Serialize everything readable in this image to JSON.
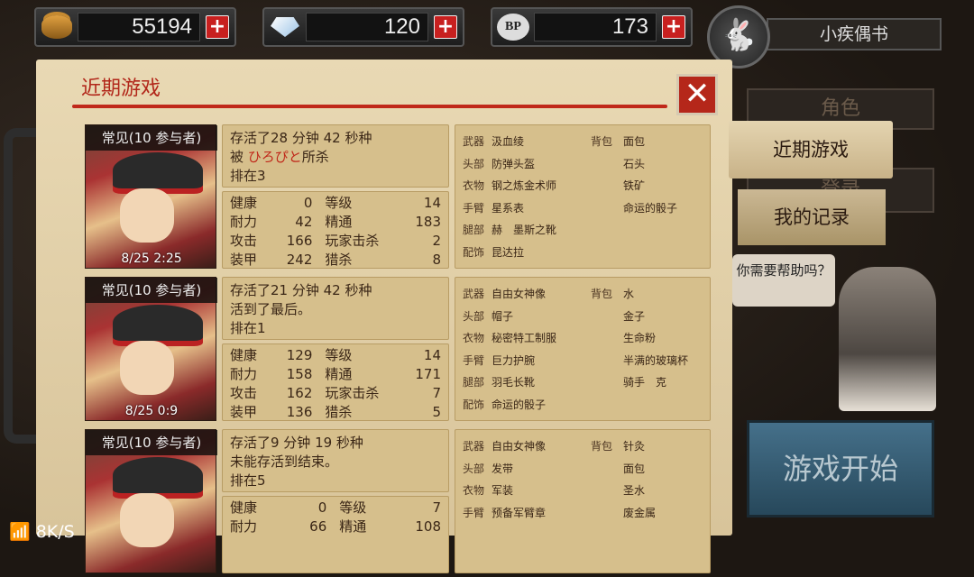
{
  "currency": {
    "gold": {
      "icon": "coin-stack-icon",
      "value": "55194",
      "plus": "+"
    },
    "gem": {
      "icon": "diamond-icon",
      "value": "120",
      "plus": "+"
    },
    "bp": {
      "icon": "bp-paw-icon",
      "icon_text": "BP",
      "value": "173",
      "plus": "+"
    }
  },
  "user": {
    "avatar_icon": "rabbit-icon",
    "name": "小疾偶书"
  },
  "panel": {
    "title": "近期游戏",
    "close_icon": "close-x-icon"
  },
  "entries": [
    {
      "label": "常见(10 参与者)",
      "date": "8/25  2:25",
      "line1": "存活了28 分钟 42 秒种",
      "line2_pre": "被 ",
      "line2_name": "ひろぴと",
      "line2_post": "所杀",
      "line3": "排在3",
      "stats": [
        [
          "健康",
          "0",
          "等级",
          "14"
        ],
        [
          "耐力",
          "42",
          "精通",
          "183"
        ],
        [
          "攻击",
          "166",
          "玩家击杀",
          "2"
        ],
        [
          "装甲",
          "242",
          "猎杀",
          "8"
        ]
      ],
      "equip": [
        [
          "武器",
          "汲血绫",
          "背包",
          "面包"
        ],
        [
          "头部",
          "防弹头盔",
          "",
          "石头"
        ],
        [
          "衣物",
          "钢之炼金术师",
          "",
          "铁矿"
        ],
        [
          "手臂",
          "星系表",
          "",
          "命运的骰子"
        ],
        [
          "腿部",
          "赫　墨斯之靴",
          "",
          ""
        ],
        [
          "配饰",
          "昆达拉",
          "",
          ""
        ]
      ]
    },
    {
      "label": "常见(10 参与者)",
      "date": "8/25  0:9",
      "line1": "存活了21 分钟 42 秒种",
      "line2_pre": "活到了最后。",
      "line2_name": "",
      "line2_post": "",
      "line3": "排在1",
      "stats": [
        [
          "健康",
          "129",
          "等级",
          "14"
        ],
        [
          "耐力",
          "158",
          "精通",
          "171"
        ],
        [
          "攻击",
          "162",
          "玩家击杀",
          "7"
        ],
        [
          "装甲",
          "136",
          "猎杀",
          "5"
        ]
      ],
      "equip": [
        [
          "武器",
          "自由女神像",
          "背包",
          "水"
        ],
        [
          "头部",
          "帽子",
          "",
          "金子"
        ],
        [
          "衣物",
          "秘密特工制服",
          "",
          "生命粉"
        ],
        [
          "手臂",
          "巨力护腕",
          "",
          "半满的玻璃杯"
        ],
        [
          "腿部",
          "羽毛长靴",
          "",
          "骑手　克"
        ],
        [
          "配饰",
          "命运的骰子",
          "",
          ""
        ]
      ]
    },
    {
      "label": "常见(10 参与者)",
      "date": "",
      "line1": "存活了9 分钟 19 秒种",
      "line2_pre": "未能存活到结束。",
      "line2_name": "",
      "line2_post": "",
      "line3": "排在5",
      "stats": [
        [
          "健康",
          "0",
          "等级",
          "7"
        ],
        [
          "耐力",
          "66",
          "精通",
          "108"
        ]
      ],
      "equip": [
        [
          "武器",
          "自由女神像",
          "背包",
          "针灸"
        ],
        [
          "头部",
          "发带",
          "",
          "面包"
        ],
        [
          "衣物",
          "军装",
          "",
          "圣水"
        ],
        [
          "手臂",
          "预备军臂章",
          "",
          "废金属"
        ]
      ]
    }
  ],
  "sidebar": {
    "tab_character": "角色",
    "tab_recent": "近期游戏",
    "tab_records": "我的记录",
    "tab_hidden": "登录",
    "help": "你需要帮助吗？",
    "start": "游戏开始"
  },
  "status": {
    "net_speed": "8K/S",
    "wifi_icon": "wifi-icon"
  }
}
